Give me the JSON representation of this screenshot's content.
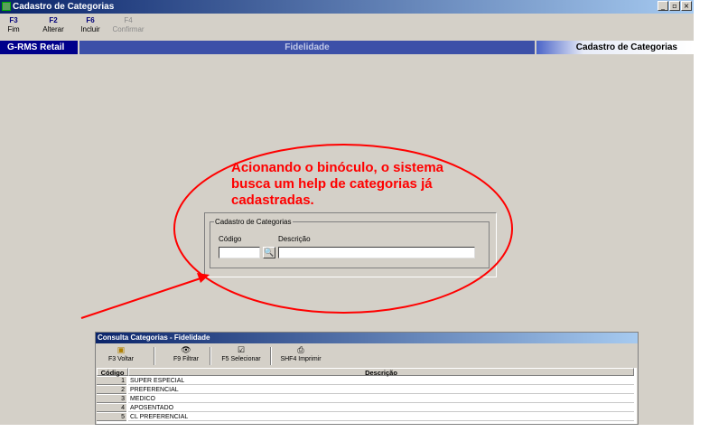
{
  "window": {
    "title": "Cadastro de Categorias",
    "controls": [
      "_",
      "▫",
      "×"
    ]
  },
  "toolbar": [
    {
      "key": "F3",
      "label": "Fim",
      "enabled": true
    },
    {
      "key": "F2",
      "label": "Alterar",
      "enabled": true
    },
    {
      "key": "F6",
      "label": "Incluir",
      "enabled": true
    },
    {
      "key": "F4",
      "label": "Confirmar",
      "enabled": false
    }
  ],
  "header_bar": {
    "left": "G-RMS Retail",
    "center": "Fidelidade",
    "right": "Cadastro de Categorias"
  },
  "form": {
    "group_title": "Cadastro de Categorias",
    "codigo_label": "Código",
    "descricao_label": "Descrição",
    "codigo_value": "",
    "descricao_value": ""
  },
  "annotation": {
    "text": "Acionando o binóculo, o sistema busca um help de categorias já cadastradas.",
    "color": "#ff0000"
  },
  "consulta": {
    "title": "Consulta Categorias - Fidelidade",
    "toolbar": [
      {
        "icon": "folder-back-icon",
        "label": "F3 Voltar"
      },
      {
        "icon": "binoculars-icon",
        "label": "F9 Filtrar"
      },
      {
        "icon": "select-icon",
        "label": "F5 Selecionar"
      },
      {
        "icon": "printer-icon",
        "label": "SHF4 Imprimir"
      }
    ],
    "columns": [
      "Código",
      "Descrição"
    ],
    "rows": [
      {
        "codigo": "1",
        "descricao": "SUPER ESPECIAL"
      },
      {
        "codigo": "2",
        "descricao": "PREFERENCIAL"
      },
      {
        "codigo": "3",
        "descricao": "MEDICO"
      },
      {
        "codigo": "4",
        "descricao": "APOSENTADO"
      },
      {
        "codigo": "5",
        "descricao": "CL PREFERENCIAL"
      }
    ]
  }
}
